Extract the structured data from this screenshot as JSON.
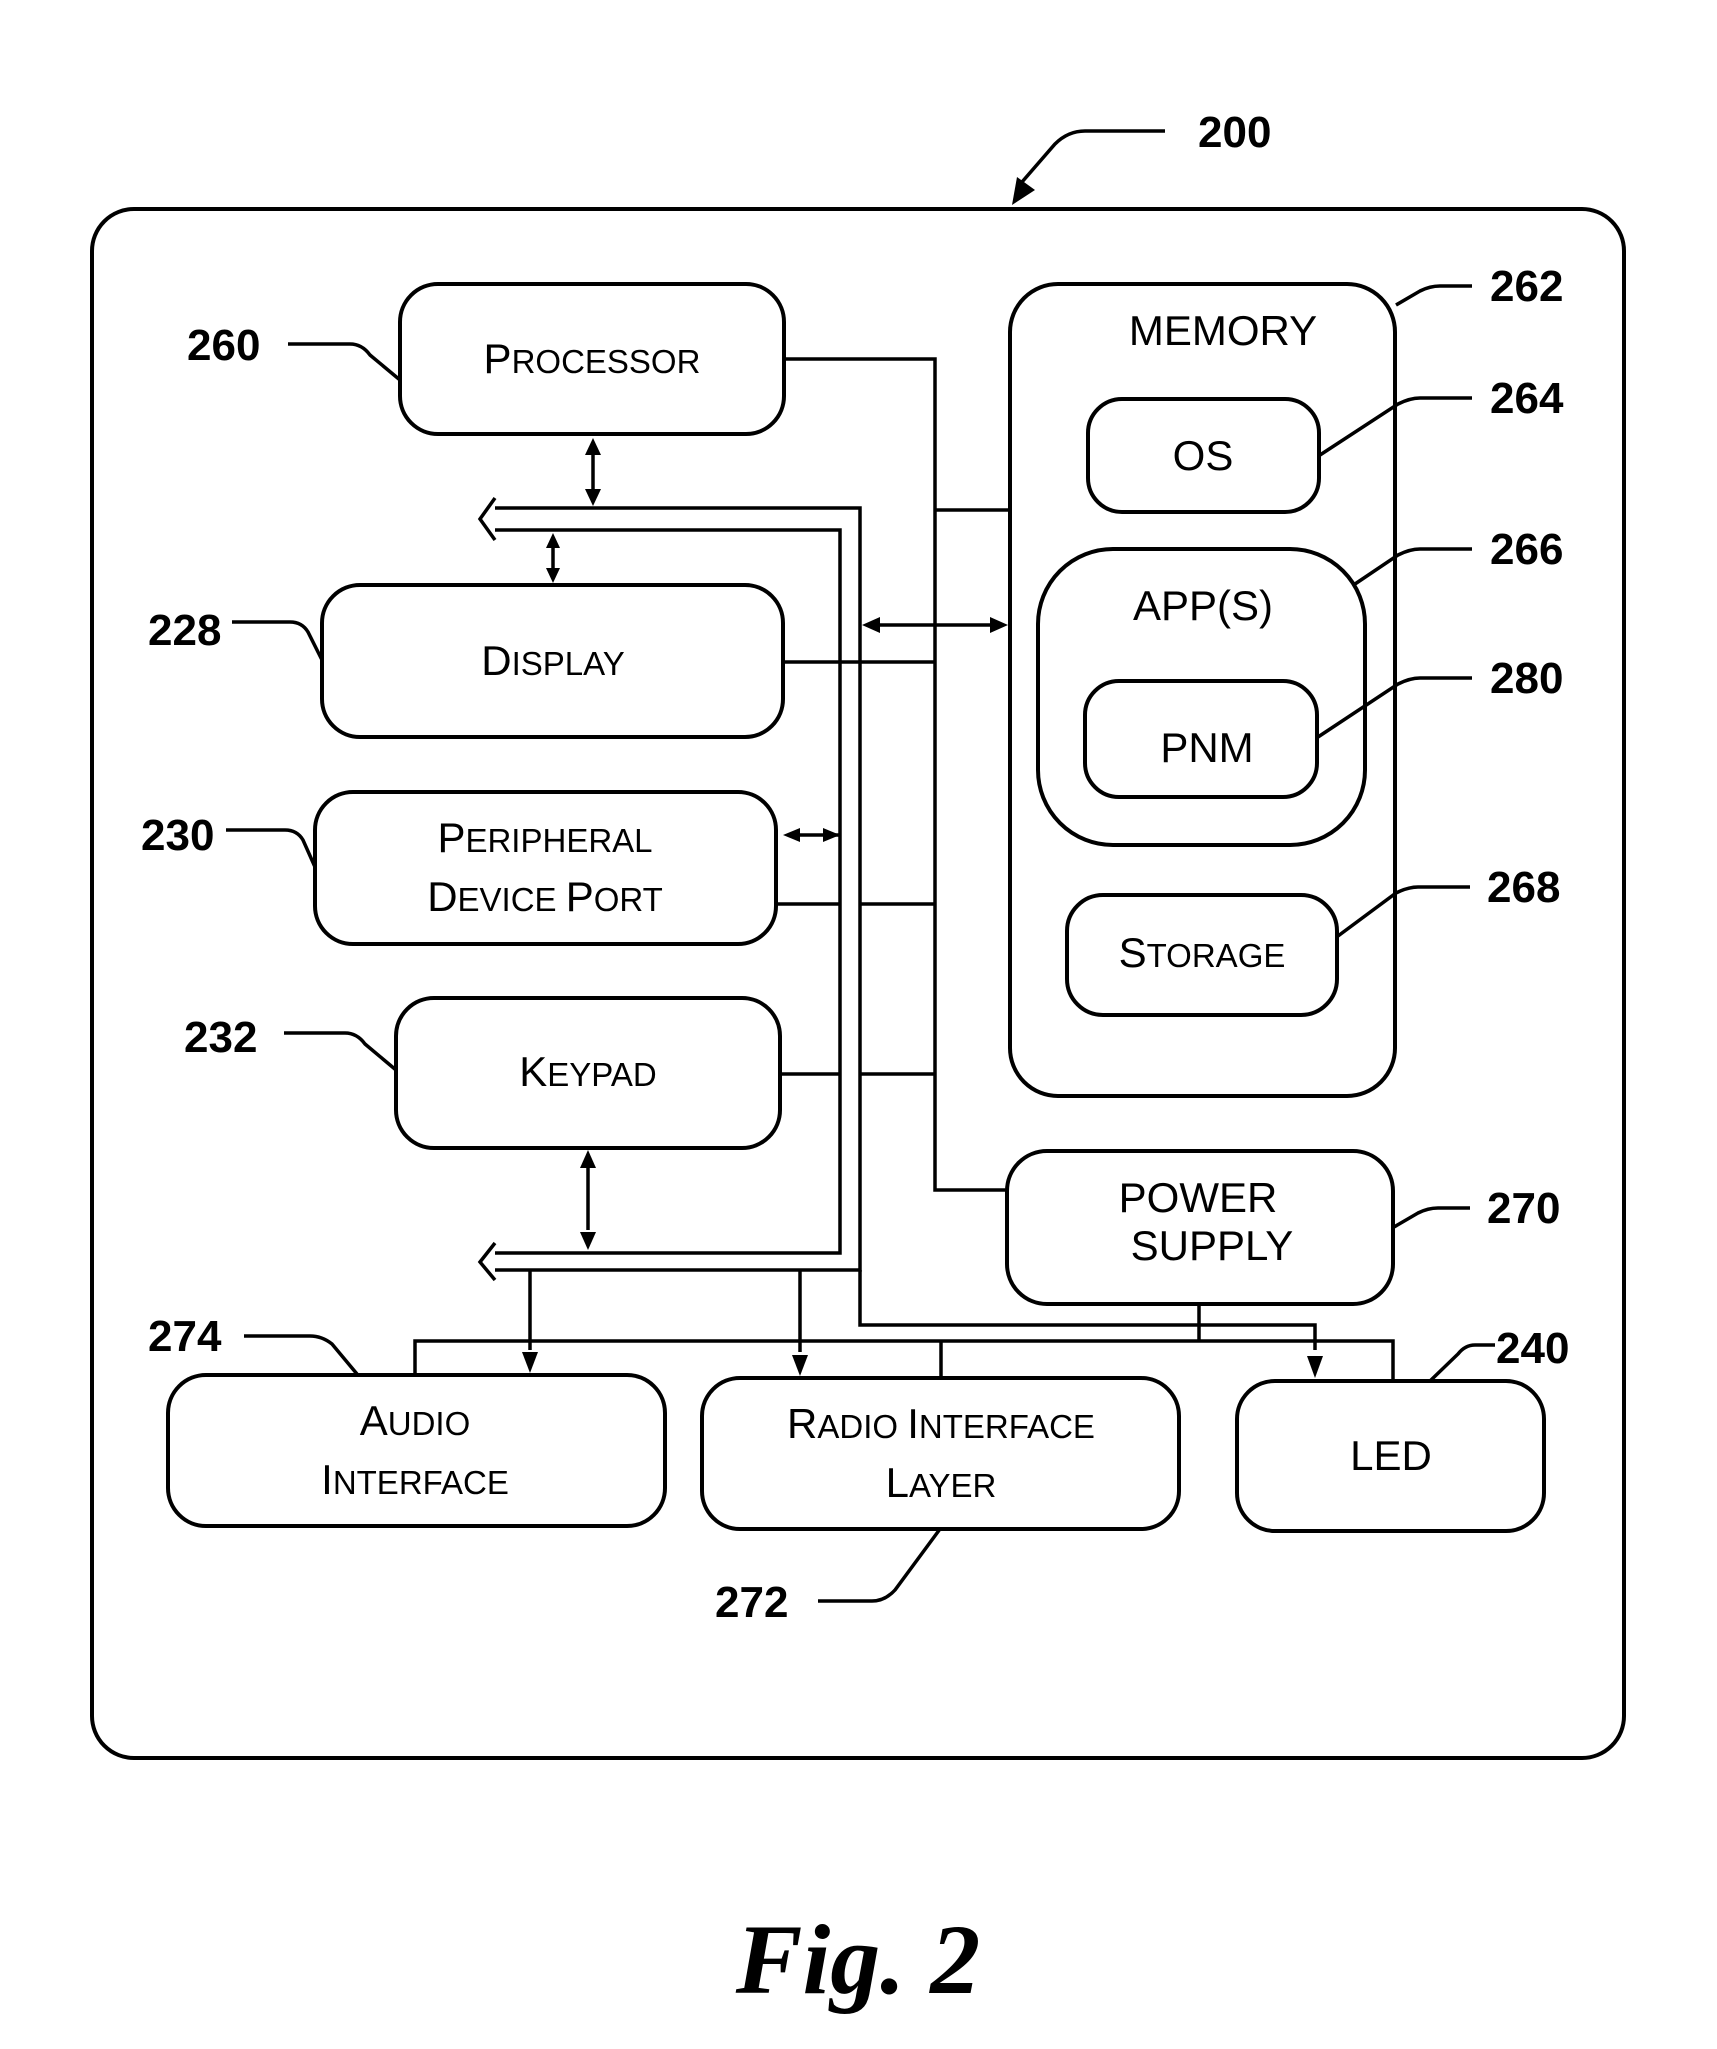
{
  "figure": {
    "caption": "Fig. 2",
    "device_ref": "200"
  },
  "blocks": {
    "processor": {
      "label_cap": "P",
      "label_rest": "ROCESSOR",
      "ref": "260"
    },
    "display": {
      "label_cap": "D",
      "label_rest": "ISPLAY",
      "ref": "228"
    },
    "peripheral": {
      "line1_cap": "P",
      "line1_rest": "ERIPHERAL",
      "line2_cap1": "D",
      "line2_rest1": "EVICE ",
      "line2_cap2": "P",
      "line2_rest2": "ORT",
      "ref": "230"
    },
    "keypad": {
      "label_cap": "K",
      "label_rest": "EYPAD",
      "ref": "232"
    },
    "memory": {
      "label": "MEMORY",
      "ref": "262"
    },
    "os": {
      "label": "OS",
      "ref": "264"
    },
    "apps": {
      "label": "APP(S)",
      "ref": "266"
    },
    "pnm": {
      "label": "PNM",
      "ref": "280"
    },
    "storage": {
      "label_cap": "S",
      "label_rest": "TORAGE",
      "ref": "268"
    },
    "power_supply": {
      "line1": "POWER",
      "line2": "SUPPLY",
      "ref": "270"
    },
    "audio": {
      "line1_cap": "A",
      "line1_rest": "UDIO",
      "line2_cap": "I",
      "line2_rest": "NTERFACE",
      "ref": "274"
    },
    "radio": {
      "line1_cap1": "R",
      "line1_rest1": "ADIO ",
      "line1_cap2": "I",
      "line1_rest2": "NTERFACE",
      "line2_cap": "L",
      "line2_rest": "AYER",
      "ref": "272"
    },
    "led": {
      "label": "LED",
      "ref": "240"
    }
  }
}
